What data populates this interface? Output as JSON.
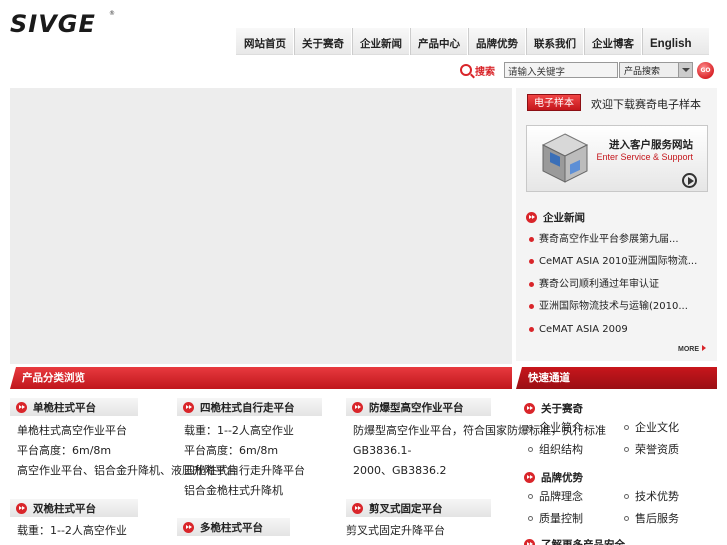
{
  "logo": {
    "text": "SIVGE",
    "reg": "®"
  },
  "nav": [
    "网站首页",
    "关于赛奇",
    "企业新闻",
    "产品中心",
    "品牌优势",
    "联系我们",
    "企业博客",
    "English"
  ],
  "search": {
    "label": "搜索",
    "input_value": "请输入关键字",
    "select_value": "产品搜索",
    "go_label": "GO"
  },
  "side": {
    "ebook_label": "电子样本",
    "ebook_text": "欢迎下载赛奇电子样本",
    "service_title": "进入客户服务网站",
    "service_sub": "Enter Service & Support",
    "news_title": "企业新闻",
    "news": [
      "赛奇高空作业平台参展第九届...",
      "CeMAT ASIA 2010亚洲国际物流...",
      "赛奇公司顺利通过年审认证",
      "亚洲国际物流技术与运输(2010...",
      "CeMAT ASIA 2009"
    ],
    "more": "MORE"
  },
  "sections": {
    "products_title": "产品分类浏览",
    "quick_title": "快速通道"
  },
  "categories": [
    {
      "title": "单桅柱式平台",
      "items": [
        "单桅柱式高空作业平台",
        "平台高度：6m/8m",
        "高空作业平台、铝合金升降机、液压升降平台"
      ]
    },
    {
      "title": "双桅柱式平台",
      "items": [
        "载重：1--2人高空作业"
      ]
    },
    {
      "title": "四桅柱式自行走平台",
      "items": [
        "载重：1--2人高空作业",
        "平台高度：6m/8m",
        "四桅柱式自行走升降平台",
        "铝合金桅柱式升降机"
      ]
    },
    {
      "title": "多桅柱式平台",
      "items": []
    },
    {
      "title": "防爆型高空作业平台",
      "items": [
        "防爆型高空作业平台，符合国家防爆标准，执行标准",
        "GB3836.1-",
        "2000、GB3836.2"
      ]
    },
    {
      "title": "剪叉式固定平台",
      "items": [
        "剪叉式固定升降平台"
      ]
    }
  ],
  "quick": [
    {
      "title": "关于赛奇",
      "items": [
        "企业简介",
        "企业文化",
        "组织结构",
        "荣誉资质"
      ]
    },
    {
      "title": "品牌优势",
      "items": [
        "品牌理念",
        "技术优势",
        "质量控制",
        "售后服务"
      ]
    },
    {
      "title": "了解更多产品安全",
      "items": []
    }
  ]
}
